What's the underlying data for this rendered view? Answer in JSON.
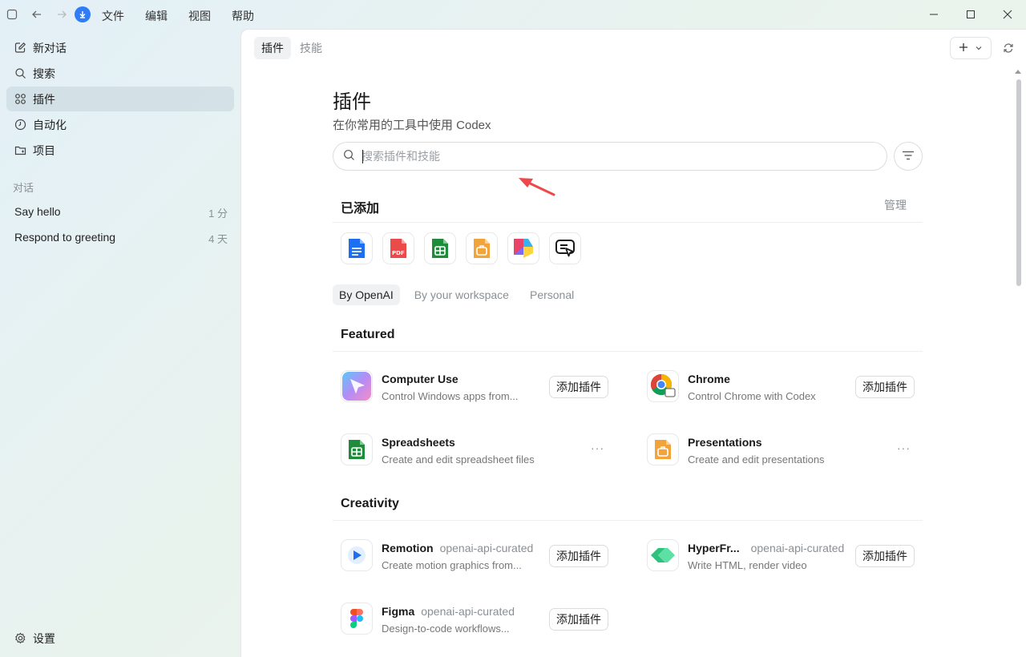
{
  "menu": [
    "文件",
    "编辑",
    "视图",
    "帮助"
  ],
  "sidebar": {
    "nav": [
      {
        "label": "新对话",
        "icon": "edit-icon"
      },
      {
        "label": "搜索",
        "icon": "search-icon"
      },
      {
        "label": "插件",
        "icon": "grid-icon"
      },
      {
        "label": "自动化",
        "icon": "clock-icon"
      },
      {
        "label": "项目",
        "icon": "folder-icon"
      }
    ],
    "section_label": "对话",
    "chats": [
      {
        "title": "Say hello",
        "time": "1 分"
      },
      {
        "title": "Respond to greeting",
        "time": "4 天"
      }
    ],
    "settings_label": "设置"
  },
  "main": {
    "tabs": [
      "插件",
      "技能"
    ],
    "title": "插件",
    "subtitle": "在你常用的工具中使用 Codex",
    "search_placeholder": "搜索插件和技能",
    "added_heading": "已添加",
    "manage_label": "管理",
    "filter_tabs": [
      "By OpenAI",
      "By your workspace",
      "Personal"
    ],
    "featured_heading": "Featured",
    "creativity_heading": "Creativity",
    "featured": [
      {
        "name": "Computer Use",
        "desc": "Control Windows apps from...",
        "action": "添加插件"
      },
      {
        "name": "Chrome",
        "desc": "Control Chrome with Codex",
        "action": "添加插件"
      },
      {
        "name": "Spreadsheets",
        "desc": "Create and edit spreadsheet files",
        "more": "···"
      },
      {
        "name": "Presentations",
        "desc": "Create and edit presentations",
        "more": "···"
      }
    ],
    "creativity": [
      {
        "name": "Remotion",
        "source": "openai-api-curated",
        "desc": "Create motion graphics from...",
        "action": "添加插件"
      },
      {
        "name": "HyperFr...",
        "source": "openai-api-curated",
        "desc": "Write HTML, render video",
        "action": "添加插件"
      },
      {
        "name": "Figma",
        "source": "openai-api-curated",
        "desc": "Design-to-code workflows...",
        "action": "添加插件"
      }
    ]
  },
  "colors": {
    "accent": "#2f7cf6",
    "annotation_arrow": "#f0474b"
  }
}
